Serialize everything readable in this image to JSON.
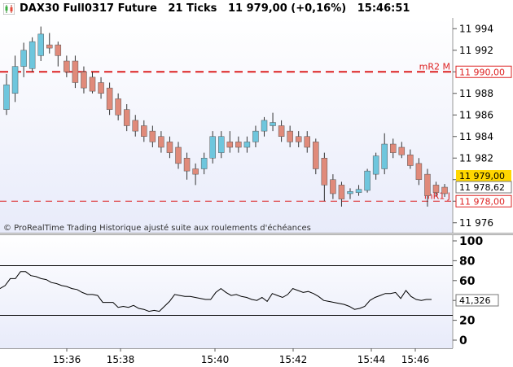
{
  "header": {
    "instrument": "DAX30 Full0317 Future",
    "interval": "21 Ticks",
    "quote": "11 979,00 (+0,16%)",
    "time": "15:46:51"
  },
  "main_chart": {
    "footer_note": "© ProRealTime Trading Historique ajusté suite aux roulements d'échéances",
    "price_ticks": [
      "11 994",
      "11 992",
      "11 990",
      "11 988",
      "11 986",
      "11 984",
      "11 982",
      "11 980",
      "11 978",
      "11 976"
    ],
    "ylim": [
      11975,
      11995
    ],
    "levels": [
      {
        "name": "mR2 M",
        "value": 11990.0,
        "label": "11 990,00"
      },
      {
        "name": "mR1 J",
        "value": 11978.0,
        "label": "11 978,00"
      }
    ],
    "current_price_label": "11 979,00",
    "cursor_price_label": "11 978,62",
    "colors": {
      "up": "#6ec6dd",
      "down": "#e08a7a",
      "level": "#dd2222",
      "background": "#eef0fb"
    }
  },
  "indicator": {
    "ticks": [
      "100",
      "80",
      "60",
      "40",
      "20",
      "0"
    ],
    "ylim": [
      0,
      100
    ],
    "levels": [
      75,
      25
    ],
    "value_label": "41,326"
  },
  "time_axis": {
    "labels": [
      "15:36",
      "15:38",
      "15:40",
      "15:42",
      "15:44",
      "15:46"
    ]
  },
  "chart_data": [
    {
      "type": "candlestick",
      "title": "DAX30 Full0317 Future",
      "ylim": [
        11975,
        11995
      ],
      "candles": [
        {
          "o": 11986.5,
          "h": 11989.8,
          "l": 11986.0,
          "c": 11988.8
        },
        {
          "o": 11988.0,
          "h": 11991.5,
          "l": 11987.2,
          "c": 11990.5
        },
        {
          "o": 11990.5,
          "h": 11992.7,
          "l": 11989.5,
          "c": 11992.0
        },
        {
          "o": 11990.3,
          "h": 11993.2,
          "l": 11990.0,
          "c": 11992.8
        },
        {
          "o": 11991.5,
          "h": 11994.2,
          "l": 11991.0,
          "c": 11993.5
        },
        {
          "o": 11992.5,
          "h": 11993.6,
          "l": 11991.7,
          "c": 11992.2
        },
        {
          "o": 11992.5,
          "h": 11992.8,
          "l": 11990.5,
          "c": 11991.5
        },
        {
          "o": 11991.0,
          "h": 11991.5,
          "l": 11989.5,
          "c": 11990.0
        },
        {
          "o": 11991.0,
          "h": 11991.5,
          "l": 11988.5,
          "c": 11989.0
        },
        {
          "o": 11990.0,
          "h": 11990.5,
          "l": 11988.0,
          "c": 11988.5
        },
        {
          "o": 11989.5,
          "h": 11990.0,
          "l": 11988.0,
          "c": 11988.2
        },
        {
          "o": 11989.0,
          "h": 11989.5,
          "l": 11987.5,
          "c": 11988.0
        },
        {
          "o": 11988.5,
          "h": 11989.0,
          "l": 11986.0,
          "c": 11986.5
        },
        {
          "o": 11987.5,
          "h": 11988.0,
          "l": 11985.5,
          "c": 11986.0
        },
        {
          "o": 11986.5,
          "h": 11987.0,
          "l": 11984.5,
          "c": 11985.0
        },
        {
          "o": 11985.5,
          "h": 11986.0,
          "l": 11984.0,
          "c": 11984.5
        },
        {
          "o": 11985.0,
          "h": 11985.5,
          "l": 11983.5,
          "c": 11984.0
        },
        {
          "o": 11984.5,
          "h": 11985.0,
          "l": 11983.0,
          "c": 11983.5
        },
        {
          "o": 11984.0,
          "h": 11984.5,
          "l": 11982.5,
          "c": 11983.0
        },
        {
          "o": 11983.5,
          "h": 11984.0,
          "l": 11982.0,
          "c": 11982.5
        },
        {
          "o": 11983.0,
          "h": 11983.5,
          "l": 11981.0,
          "c": 11981.5
        },
        {
          "o": 11982.0,
          "h": 11982.5,
          "l": 11980.0,
          "c": 11980.8
        },
        {
          "o": 11981.0,
          "h": 11981.5,
          "l": 11979.5,
          "c": 11980.5
        },
        {
          "o": 11981.0,
          "h": 11982.5,
          "l": 11980.5,
          "c": 11982.0
        },
        {
          "o": 11982.0,
          "h": 11984.5,
          "l": 11981.5,
          "c": 11984.0
        },
        {
          "o": 11982.5,
          "h": 11984.5,
          "l": 11982.0,
          "c": 11984.0
        },
        {
          "o": 11983.5,
          "h": 11984.5,
          "l": 11982.5,
          "c": 11983.0
        },
        {
          "o": 11983.5,
          "h": 11984.0,
          "l": 11982.5,
          "c": 11983.0
        },
        {
          "o": 11983.0,
          "h": 11984.0,
          "l": 11982.5,
          "c": 11983.5
        },
        {
          "o": 11983.5,
          "h": 11985.0,
          "l": 11983.0,
          "c": 11984.5
        },
        {
          "o": 11984.5,
          "h": 11985.8,
          "l": 11984.0,
          "c": 11985.5
        },
        {
          "o": 11985.0,
          "h": 11986.2,
          "l": 11984.5,
          "c": 11985.3
        },
        {
          "o": 11985.0,
          "h": 11985.5,
          "l": 11983.5,
          "c": 11984.0
        },
        {
          "o": 11984.5,
          "h": 11985.0,
          "l": 11983.0,
          "c": 11983.5
        },
        {
          "o": 11984.0,
          "h": 11984.5,
          "l": 11983.0,
          "c": 11983.5
        },
        {
          "o": 11984.0,
          "h": 11984.5,
          "l": 11982.5,
          "c": 11983.0
        },
        {
          "o": 11983.5,
          "h": 11983.8,
          "l": 11980.5,
          "c": 11981.0
        },
        {
          "o": 11982.0,
          "h": 11982.5,
          "l": 11978.0,
          "c": 11979.5
        },
        {
          "o": 11980.0,
          "h": 11980.5,
          "l": 11978.2,
          "c": 11978.7
        },
        {
          "o": 11979.5,
          "h": 11979.8,
          "l": 11977.5,
          "c": 11978.2
        },
        {
          "o": 11978.7,
          "h": 11979.2,
          "l": 11978.2,
          "c": 11978.9
        },
        {
          "o": 11978.8,
          "h": 11979.5,
          "l": 11978.5,
          "c": 11979.1
        },
        {
          "o": 11979.0,
          "h": 11981.0,
          "l": 11978.8,
          "c": 11980.8
        },
        {
          "o": 11980.5,
          "h": 11982.5,
          "l": 11980.0,
          "c": 11982.2
        },
        {
          "o": 11981.0,
          "h": 11984.3,
          "l": 11980.5,
          "c": 11983.3
        },
        {
          "o": 11983.3,
          "h": 11983.8,
          "l": 11982.0,
          "c": 11982.5
        },
        {
          "o": 11983.0,
          "h": 11983.5,
          "l": 11982.0,
          "c": 11982.3
        },
        {
          "o": 11982.3,
          "h": 11982.8,
          "l": 11981.0,
          "c": 11981.3
        },
        {
          "o": 11981.5,
          "h": 11982.0,
          "l": 11979.5,
          "c": 11980.0
        },
        {
          "o": 11980.5,
          "h": 11981.0,
          "l": 11977.5,
          "c": 11978.5
        },
        {
          "o": 11979.5,
          "h": 11979.8,
          "l": 11978.5,
          "c": 11978.8
        },
        {
          "o": 11979.3,
          "h": 11979.6,
          "l": 11978.4,
          "c": 11978.7
        }
      ]
    },
    {
      "type": "line",
      "ylim": [
        0,
        100
      ],
      "levels": [
        75,
        25
      ],
      "series": [
        {
          "values": [
            52,
            55,
            62,
            62,
            69,
            69,
            65,
            64,
            62,
            61,
            58,
            57,
            55,
            54,
            52,
            51,
            48,
            46,
            46,
            45,
            38,
            38,
            38,
            33,
            34,
            33,
            35,
            32,
            31,
            29,
            30,
            29,
            34,
            39,
            46,
            45,
            44,
            44,
            43,
            42,
            41,
            41,
            48,
            52,
            48,
            45,
            46,
            44,
            43,
            41,
            40,
            43,
            39,
            47,
            45,
            43,
            46,
            52,
            50,
            48,
            49,
            47,
            44,
            40,
            39,
            38,
            37,
            36,
            34,
            31,
            32,
            34,
            40,
            43,
            45,
            47,
            47,
            48,
            42,
            50,
            44,
            41,
            40,
            41,
            41
          ]
        }
      ]
    }
  ]
}
